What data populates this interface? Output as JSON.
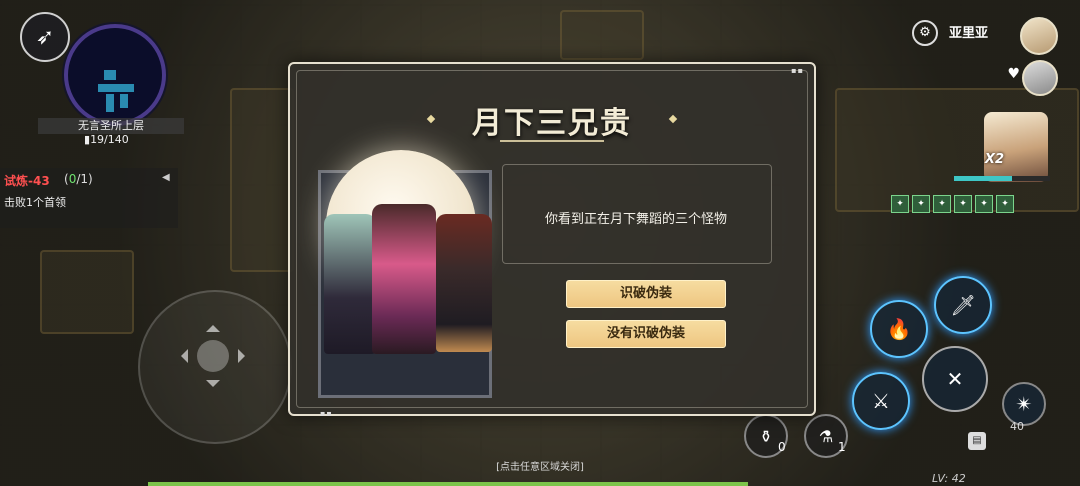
{
  "hud": {
    "back_icon": "wing-icon",
    "location_name": "无言圣所上层",
    "room_count": "19/140",
    "quest": {
      "title": "试炼-43",
      "progress_open": "(",
      "progress_done": "0",
      "progress_rest": "/1)",
      "collapse_glyph": "◀",
      "description": "击败1个首领"
    }
  },
  "player": {
    "name": "亚里亚",
    "combo": "X2",
    "hp_fraction": 0.6,
    "level": "LV: 42",
    "buffs": [
      "✦",
      "✦",
      "✦",
      "✦",
      "✦",
      "✦"
    ]
  },
  "skills": {
    "potion_1_count": "0",
    "potion_2_count": "1",
    "special_count": "40"
  },
  "dialog": {
    "title": "月下三兄贵",
    "description": "你看到正在月下舞蹈的三个怪物",
    "choices": [
      "识破伪装",
      "没有识破伪装"
    ]
  },
  "footer": {
    "close_hint": "[点击任意区域关闭]"
  },
  "colors": {
    "accent_gold": "#eec681",
    "skill_glow": "#5cc4ff",
    "quest_red": "#ff5050",
    "quest_green": "#6fe36f"
  }
}
